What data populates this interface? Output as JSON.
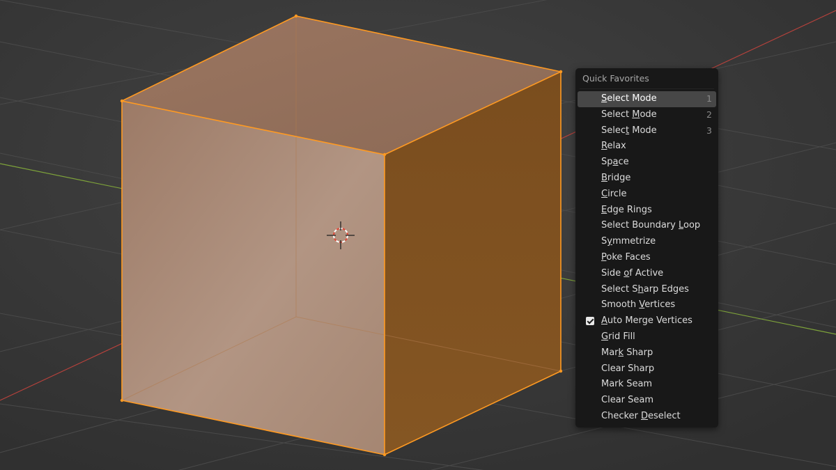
{
  "menu": {
    "title": "Quick Favorites",
    "items": [
      {
        "pre": "",
        "ul": "S",
        "post": "elect Mode",
        "shortcut": "1",
        "active": true,
        "checked": false
      },
      {
        "pre": "Select ",
        "ul": "M",
        "post": "ode",
        "shortcut": "2",
        "active": false,
        "checked": false
      },
      {
        "pre": "Selec",
        "ul": "t",
        "post": " Mode",
        "shortcut": "3",
        "active": false,
        "checked": false
      },
      {
        "pre": "",
        "ul": "R",
        "post": "elax",
        "shortcut": "",
        "active": false,
        "checked": false
      },
      {
        "pre": "Sp",
        "ul": "a",
        "post": "ce",
        "shortcut": "",
        "active": false,
        "checked": false
      },
      {
        "pre": "",
        "ul": "B",
        "post": "ridge",
        "shortcut": "",
        "active": false,
        "checked": false
      },
      {
        "pre": "",
        "ul": "C",
        "post": "ircle",
        "shortcut": "",
        "active": false,
        "checked": false
      },
      {
        "pre": "",
        "ul": "E",
        "post": "dge Rings",
        "shortcut": "",
        "active": false,
        "checked": false
      },
      {
        "pre": "Select Boundary ",
        "ul": "L",
        "post": "oop",
        "shortcut": "",
        "active": false,
        "checked": false
      },
      {
        "pre": "S",
        "ul": "y",
        "post": "mmetrize",
        "shortcut": "",
        "active": false,
        "checked": false
      },
      {
        "pre": "",
        "ul": "P",
        "post": "oke Faces",
        "shortcut": "",
        "active": false,
        "checked": false
      },
      {
        "pre": "Side ",
        "ul": "o",
        "post": "f Active",
        "shortcut": "",
        "active": false,
        "checked": false
      },
      {
        "pre": "Select S",
        "ul": "h",
        "post": "arp Edges",
        "shortcut": "",
        "active": false,
        "checked": false
      },
      {
        "pre": "Smooth ",
        "ul": "V",
        "post": "ertices",
        "shortcut": "",
        "active": false,
        "checked": false
      },
      {
        "pre": "",
        "ul": "A",
        "post": "uto Merge Vertices",
        "shortcut": "",
        "active": false,
        "checked": true
      },
      {
        "pre": "",
        "ul": "G",
        "post": "rid Fill",
        "shortcut": "",
        "active": false,
        "checked": false
      },
      {
        "pre": "Mar",
        "ul": "k",
        "post": " Sharp",
        "shortcut": "",
        "active": false,
        "checked": false
      },
      {
        "pre": "Clear Sharp",
        "ul": "",
        "post": "",
        "shortcut": "",
        "active": false,
        "checked": false
      },
      {
        "pre": "Mark Seam",
        "ul": "",
        "post": "",
        "shortcut": "",
        "active": false,
        "checked": false
      },
      {
        "pre": "Clear Seam",
        "ul": "",
        "post": "",
        "shortcut": "",
        "active": false,
        "checked": false
      },
      {
        "pre": "Checker ",
        "ul": "D",
        "post": "eselect",
        "shortcut": "",
        "active": false,
        "checked": false
      }
    ]
  },
  "colors": {
    "background": "#3b3b3b",
    "menu_bg": "#181818",
    "menu_active": "#474747",
    "cube_selected_edge": "#ff9a22",
    "axis_x": "#b8423c",
    "axis_y": "#7ea33a"
  },
  "icons": [
    "3d-cursor-icon",
    "checkbox-checked-icon"
  ]
}
